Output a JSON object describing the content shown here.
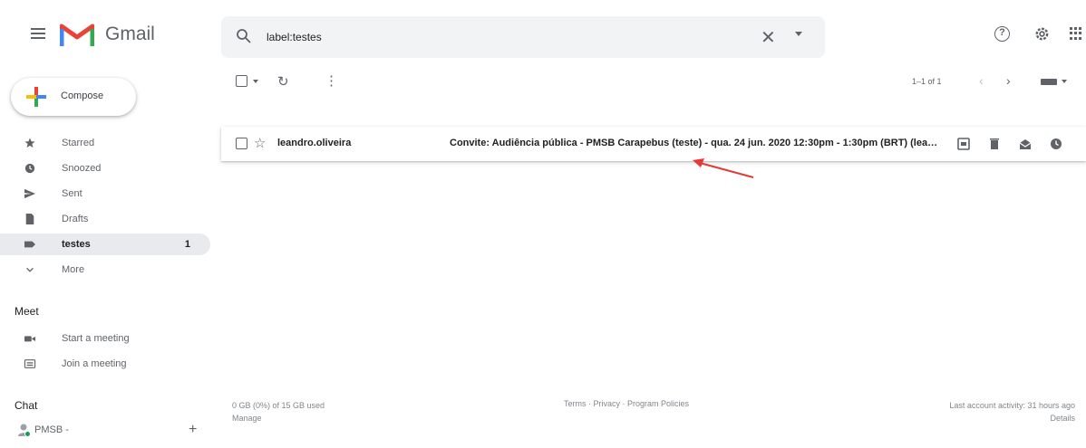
{
  "app": {
    "name": "Gmail",
    "brand_colors": {
      "red": "#ea4335",
      "blue": "#4285f4",
      "green": "#34a853",
      "yellow": "#fbbc04"
    },
    "icons": [
      "menu-icon",
      "gmail-logo-icon",
      "help-icon",
      "settings-gear-icon",
      "apps-grid-icon"
    ]
  },
  "search": {
    "value": "label:testes",
    "clear_icon": "close-icon",
    "options_icon": "caret-down-icon"
  },
  "compose": {
    "label": "Compose",
    "icon": "compose-plus-icon"
  },
  "sidebar": {
    "items": [
      {
        "label": "Starred",
        "icon": "star-icon",
        "count": ""
      },
      {
        "label": "Snoozed",
        "icon": "clock-icon",
        "count": ""
      },
      {
        "label": "Sent",
        "icon": "send-icon",
        "count": ""
      },
      {
        "label": "Drafts",
        "icon": "draft-icon",
        "count": ""
      },
      {
        "label": "testes",
        "icon": "label-icon",
        "count": "1",
        "active": true
      },
      {
        "label": "More",
        "icon": "chevron-down-icon",
        "count": ""
      }
    ]
  },
  "meet": {
    "heading": "Meet",
    "items": [
      {
        "label": "Start a meeting",
        "icon": "video-icon"
      },
      {
        "label": "Join a meeting",
        "icon": "keyboard-icon"
      }
    ]
  },
  "chat": {
    "heading": "Chat",
    "user": "PMSB -",
    "status_color": "#0f9d58",
    "add_label": "+"
  },
  "toolbar": {
    "refresh": "↻",
    "more": "⋮",
    "pager": "1–1 of 1",
    "prev": "‹",
    "next": "›"
  },
  "messages": [
    {
      "sender": "leandro.oliveira",
      "subject": "Convite: Audiência pública - PMSB Carapebus (teste) - qua. 24 jun. 2020 12:30pm - 1:30pm (BRT) (leandro.oliveira@...)",
      "star": "☆",
      "actions": [
        "archive-icon",
        "delete-icon",
        "mark-read-icon",
        "snooze-icon"
      ]
    }
  ],
  "footer": {
    "storage": "0 GB (0%) of 15 GB used",
    "manage": "Manage",
    "links": "Terms · Privacy · Program Policies",
    "activity": "Last account activity: 31 hours ago",
    "details": "Details"
  },
  "annotation": {
    "arrow_color": "#e53935"
  }
}
